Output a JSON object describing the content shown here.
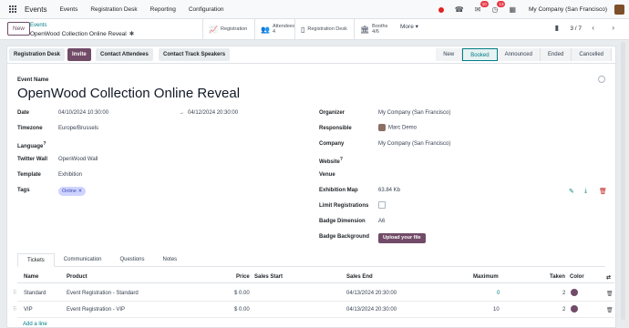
{
  "navbar": {
    "brand": "Events",
    "menus": [
      "Events",
      "Registration Desk",
      "Reporting",
      "Configuration"
    ],
    "messages_count": "10",
    "activities_count": "13",
    "company": "My Company (San Francisco)"
  },
  "control": {
    "new_label": "New",
    "breadcrumb_parent": "Events",
    "breadcrumb_current": "OpenWood Collection Online Reveal",
    "smart_buttons": [
      {
        "icon": "chart-icon",
        "label": "Registration"
      },
      {
        "icon": "users-icon",
        "label": "Attendees",
        "count": "4"
      },
      {
        "icon": "desk-icon",
        "label": "Registration Desk"
      },
      {
        "icon": "booth-icon",
        "label": "Booths",
        "count": "4/6"
      }
    ],
    "more_label": "More",
    "pager": "3 / 7"
  },
  "header": {
    "buttons": [
      "Registration Desk",
      "Invite",
      "Contact Attendees",
      "Contact Track Speakers"
    ],
    "stages": [
      "New",
      "Booked",
      "Announced",
      "Ended",
      "Cancelled"
    ],
    "active_stage": "Booked"
  },
  "event": {
    "name_label": "Event Name",
    "name": "OpenWood Collection Online Reveal",
    "date_label": "Date",
    "date_start": "04/10/2024 10:30:00",
    "date_end": "04/12/2024 20:30:00",
    "timezone_label": "Timezone",
    "timezone": "Europe/Brussels",
    "language_label": "Language",
    "twitter_label": "Twitter Wall",
    "twitter": "OpenWood Wall",
    "template_label": "Template",
    "template": "Exhibition",
    "tags_label": "Tags",
    "tag": "Online",
    "organizer_label": "Organizer",
    "organizer": "My Company (San Francisco)",
    "responsible_label": "Responsible",
    "responsible": "Marc Demo",
    "company_label": "Company",
    "company": "My Company (San Francisco)",
    "website_label": "Website",
    "venue_label": "Venue",
    "exhibition_map_label": "Exhibition Map",
    "exhibition_map": "63.84 Kb",
    "limit_label": "Limit Registrations",
    "badge_dim_label": "Badge Dimension",
    "badge_dim": "A6",
    "badge_bg_label": "Badge Background",
    "upload_label": "Upload your file"
  },
  "tabs": [
    "Tickets",
    "Communication",
    "Questions",
    "Notes"
  ],
  "active_tab": "Tickets",
  "tickets": {
    "columns": [
      "Name",
      "Product",
      "Price",
      "Sales Start",
      "Sales End",
      "Maximum",
      "Taken",
      "Color"
    ],
    "rows": [
      {
        "name": "Standard",
        "product": "Event Registration - Standard",
        "price": "$ 0.00",
        "sales_start": "",
        "sales_end": "04/13/2024 20:30:00",
        "maximum": "0",
        "taken": "2"
      },
      {
        "name": "VIP",
        "product": "Event Registration - VIP",
        "price": "$ 0.00",
        "sales_start": "",
        "sales_end": "04/13/2024 20:30:00",
        "maximum": "10",
        "taken": "2"
      }
    ],
    "add_line": "Add a line"
  }
}
